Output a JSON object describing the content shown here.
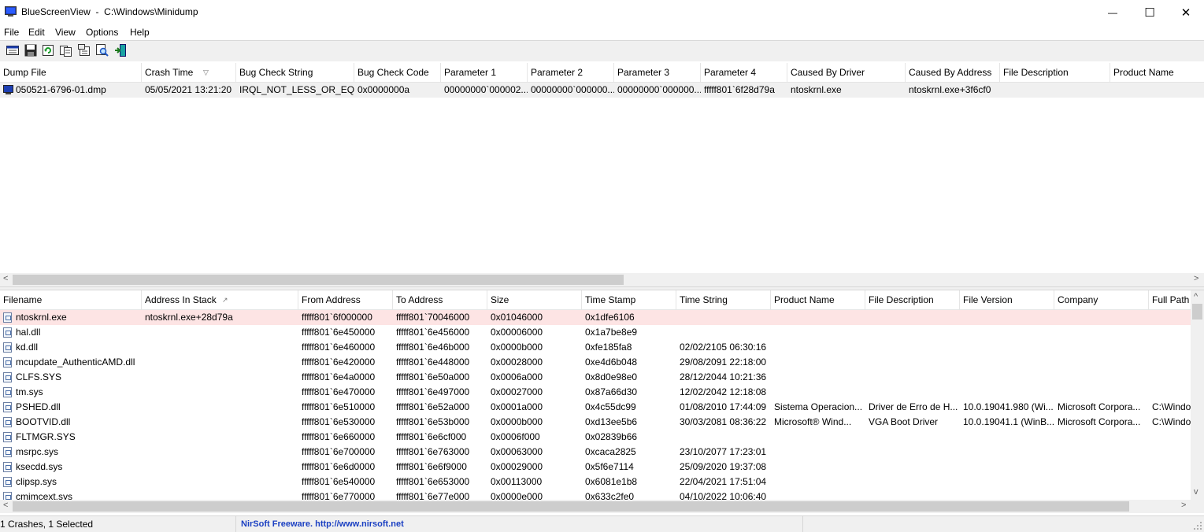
{
  "window": {
    "title": "BlueScreenView  -  C:\\Windows\\Minidump",
    "minimize_glyph": "—",
    "maximize_glyph": "☐",
    "close_glyph": "✕"
  },
  "menu": [
    "File",
    "Edit",
    "View",
    "Options",
    "Help"
  ],
  "toolbar": {
    "icons": [
      "html-report-icon",
      "save-icon",
      "refresh-icon",
      "copy-icon",
      "properties-icon",
      "find-icon",
      "exit-icon"
    ]
  },
  "top_table": {
    "columns": [
      "Dump File",
      "Crash Time",
      "Bug Check String",
      "Bug Check Code",
      "Parameter 1",
      "Parameter 2",
      "Parameter 3",
      "Parameter 4",
      "Caused By Driver",
      "Caused By Address",
      "File Description",
      "Product Name"
    ],
    "sort_indicator": "▽",
    "rows": [
      [
        "050521-6796-01.dmp",
        "05/05/2021 13:21:20",
        "IRQL_NOT_LESS_OR_EQ...",
        "0x0000000a",
        "00000000`000002...",
        "00000000`000000...",
        "00000000`000000...",
        "fffff801`6f28d79a",
        "ntoskrnl.exe",
        "ntoskrnl.exe+3f6cf0",
        "",
        ""
      ]
    ]
  },
  "bottom_table": {
    "columns": [
      "Filename",
      "Address In Stack",
      "From Address",
      "To Address",
      "Size",
      "Time Stamp",
      "Time String",
      "Product Name",
      "File Description",
      "File Version",
      "Company",
      "Full Path"
    ],
    "sort_indicator": "↗",
    "rows": [
      [
        "ntoskrnl.exe",
        "ntoskrnl.exe+28d79a",
        "fffff801`6f000000",
        "fffff801`70046000",
        "0x01046000",
        "0x1dfe6106",
        "",
        "",
        "",
        "",
        "",
        ""
      ],
      [
        "hal.dll",
        "",
        "fffff801`6e450000",
        "fffff801`6e456000",
        "0x00006000",
        "0x1a7be8e9",
        "",
        "",
        "",
        "",
        "",
        ""
      ],
      [
        "kd.dll",
        "",
        "fffff801`6e460000",
        "fffff801`6e46b000",
        "0x0000b000",
        "0xfe185fa8",
        "02/02/2105 06:30:16",
        "",
        "",
        "",
        "",
        ""
      ],
      [
        "mcupdate_AuthenticAMD.dll",
        "",
        "fffff801`6e420000",
        "fffff801`6e448000",
        "0x00028000",
        "0xe4d6b048",
        "29/08/2091 22:18:00",
        "",
        "",
        "",
        "",
        ""
      ],
      [
        "CLFS.SYS",
        "",
        "fffff801`6e4a0000",
        "fffff801`6e50a000",
        "0x0006a000",
        "0x8d0e98e0",
        "28/12/2044 10:21:36",
        "",
        "",
        "",
        "",
        ""
      ],
      [
        "tm.sys",
        "",
        "fffff801`6e470000",
        "fffff801`6e497000",
        "0x00027000",
        "0x87a66d30",
        "12/02/2042 12:18:08",
        "",
        "",
        "",
        "",
        ""
      ],
      [
        "PSHED.dll",
        "",
        "fffff801`6e510000",
        "fffff801`6e52a000",
        "0x0001a000",
        "0x4c55dc99",
        "01/08/2010 17:44:09",
        "Sistema Operacion...",
        "Driver de Erro de H...",
        "10.0.19041.980 (Wi...",
        "Microsoft Corpora...",
        "C:\\Windo"
      ],
      [
        "BOOTVID.dll",
        "",
        "fffff801`6e530000",
        "fffff801`6e53b000",
        "0x0000b000",
        "0xd13ee5b6",
        "30/03/2081 08:36:22",
        "Microsoft® Wind...",
        "VGA Boot Driver",
        "10.0.19041.1 (WinB...",
        "Microsoft Corpora...",
        "C:\\Windo"
      ],
      [
        "FLTMGR.SYS",
        "",
        "fffff801`6e660000",
        "fffff801`6e6cf000",
        "0x0006f000",
        "0x02839b66",
        "",
        "",
        "",
        "",
        "",
        ""
      ],
      [
        "msrpc.sys",
        "",
        "fffff801`6e700000",
        "fffff801`6e763000",
        "0x00063000",
        "0xcaca2825",
        "23/10/2077 17:23:01",
        "",
        "",
        "",
        "",
        ""
      ],
      [
        "ksecdd.sys",
        "",
        "fffff801`6e6d0000",
        "fffff801`6e6f9000",
        "0x00029000",
        "0x5f6e7114",
        "25/09/2020 19:37:08",
        "",
        "",
        "",
        "",
        ""
      ],
      [
        "clipsp.sys",
        "",
        "fffff801`6e540000",
        "fffff801`6e653000",
        "0x00113000",
        "0x6081e1b8",
        "22/04/2021 17:51:04",
        "",
        "",
        "",
        "",
        ""
      ],
      [
        "cmimcext.sys",
        "",
        "fffff801`6e770000",
        "fffff801`6e77e000",
        "0x0000e000",
        "0x633c2fe0",
        "04/10/2022 10:06:40",
        "",
        "",
        "",
        "",
        ""
      ]
    ]
  },
  "statusbar": {
    "count": "1 Crashes, 1 Selected",
    "credit": "NirSoft Freeware.  http://www.nirsoft.net"
  },
  "colors": {
    "highlight_row": "#fde4e4",
    "selected_row": "#f0f0f0",
    "credit_text": "#1a3fc2"
  }
}
